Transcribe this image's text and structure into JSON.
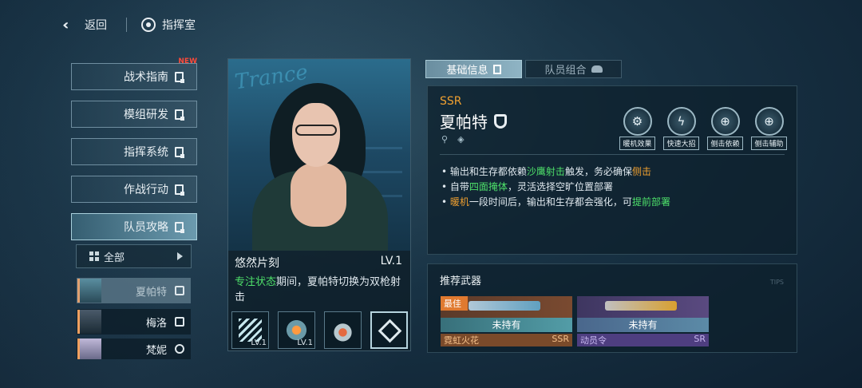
{
  "topbar": {
    "back_label": "返回",
    "room_label": "指挥室"
  },
  "menu": {
    "items": [
      {
        "label": "战术指南",
        "badge": "NEW"
      },
      {
        "label": "模组研发"
      },
      {
        "label": "指挥系统"
      },
      {
        "label": "作战行动"
      },
      {
        "label": "队员攻略",
        "active": true
      }
    ],
    "filter_label": "全部"
  },
  "characters": [
    {
      "name": "夏帕特",
      "selected": true
    },
    {
      "name": "梅洛"
    },
    {
      "name": "梵妮"
    }
  ],
  "card": {
    "neon": "Trance",
    "skill_title": "悠然片刻",
    "skill_level": "LV.1",
    "desc_part1": "专注状态",
    "desc_part2": "期间，夏帕特切换为双枪射击",
    "skills": [
      {
        "icon": "dash-skill-icon",
        "level": "LV.1"
      },
      {
        "icon": "shot-skill-icon",
        "level": "LV.1"
      },
      {
        "icon": "heart-skill-icon",
        "level": ""
      },
      {
        "icon": "crystal-skill-icon",
        "level": "",
        "selected": true
      }
    ]
  },
  "tabs": [
    {
      "label": "基础信息",
      "active": true
    },
    {
      "label": "队员组合"
    }
  ],
  "info": {
    "rarity": "SSR",
    "name": "夏帕特",
    "traits": [
      {
        "label": "暖机效果",
        "glyph": "⚙"
      },
      {
        "label": "快速大招",
        "glyph": "ϟ"
      },
      {
        "label": "侧击依赖",
        "glyph": "⊕"
      },
      {
        "label": "侧击辅助",
        "glyph": "⊕"
      }
    ],
    "bullets": [
      {
        "a": "输出和生存都依赖",
        "g": "沙鹰射击",
        "b": "触发，务必确保",
        "o": "侧击"
      },
      {
        "a": "自带",
        "g": "四面掩体",
        "b": "，灵活选择空旷位置部署"
      },
      {
        "o1": "暖机",
        "b": "一段时间后，输出和生存都会强化，可",
        "g2": "提前部署"
      }
    ]
  },
  "weapons": {
    "title": "推荐武器",
    "subtitle": "TIPS",
    "items": [
      {
        "best": "最佳",
        "status": "未持有",
        "name": "霓虹火花",
        "rarity": "SSR"
      },
      {
        "status": "未持有",
        "name": "动员令",
        "rarity": "SR"
      }
    ]
  },
  "colors": {
    "accent_green": "#4ee06a",
    "accent_orange": "#f0a030",
    "new_badge": "#ff4a3a"
  }
}
